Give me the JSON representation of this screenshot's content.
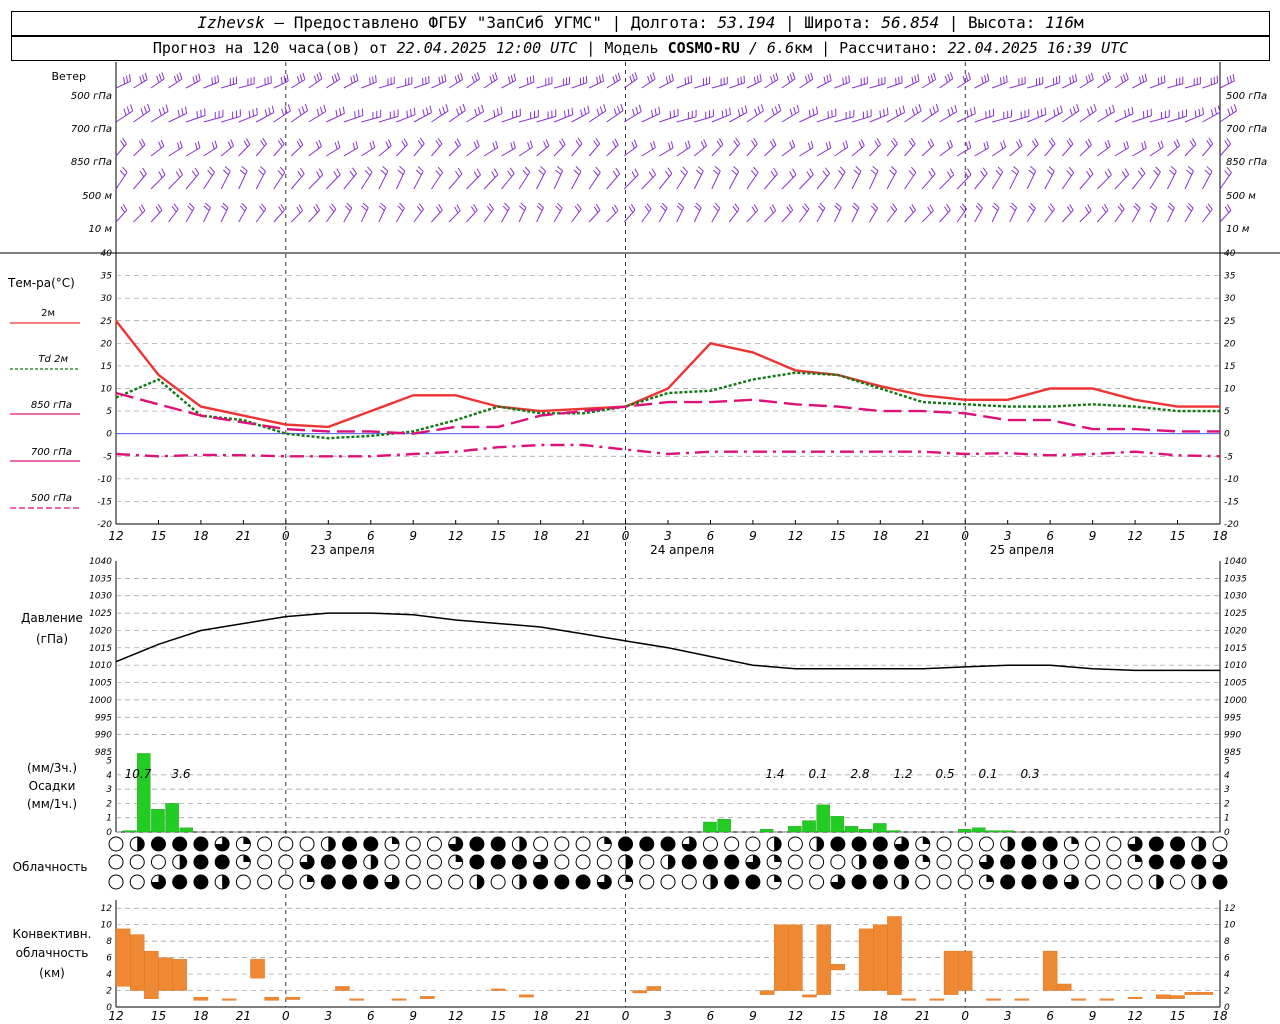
{
  "header": {
    "station": "Izhevsk",
    "provider": " – Предоставлено ФГБУ \"ЗапСиб УГМС\" | Долгота: ",
    "lon": "53.194",
    "lat_label": " | Широта: ",
    "lat": "56.854",
    "alt_label": " | Высота: ",
    "alt": "116",
    "alt_unit": "м",
    "forecast_label": "Прогноз на 120 часа(ов) от ",
    "forecast_start": "22.04.2025 12:00 UTC",
    "model_label": " | Модель ",
    "model": "COSMO-RU",
    "res": " / 6.6",
    "res_unit": "км",
    "calc_label": " | Рассчитано: ",
    "calc_time": "22.04.2025 16:39 UTC"
  },
  "colors": {
    "t2m": "#ee3333",
    "td2m": "#117711",
    "t850": "#dd1177",
    "t700": "#dd1177",
    "t500": "#dd1177",
    "wind": "#8833cc",
    "precip": "#22cc22",
    "convective": "#ee8833",
    "pressure": "#000000"
  },
  "x_ticks": [
    "12",
    "15",
    "18",
    "21",
    "0",
    "3",
    "6",
    "9",
    "12",
    "15",
    "18",
    "21",
    "0",
    "3",
    "6",
    "9",
    "12",
    "15",
    "18",
    "21",
    "0",
    "3",
    "6",
    "9",
    "12",
    "15",
    "18"
  ],
  "day_labels": [
    "23 апреля",
    "24 апреля",
    "25 апреля"
  ],
  "wind": {
    "title": "Ветер",
    "levels": [
      "500 гПа",
      "700 гПа",
      "850 гПа",
      "500 м",
      "10 м"
    ]
  },
  "temp_panel": {
    "title": "Тем-ра(°C)",
    "legend": [
      "2м",
      "Td 2м",
      "850 гПа",
      "700 гПа",
      "500 гПа"
    ],
    "y_ticks": [
      "40",
      "35",
      "30",
      "25",
      "20",
      "15",
      "10",
      "5",
      "0",
      "-5",
      "-10",
      "-15",
      "-20"
    ]
  },
  "pressure_panel": {
    "title": "Давление",
    "unit": "(гПа)",
    "y_ticks": [
      "1040",
      "1035",
      "1030",
      "1025",
      "1020",
      "1015",
      "1010",
      "1005",
      "1000",
      "995",
      "990",
      "985"
    ]
  },
  "precip_panel": {
    "unit_top": "(мм/3ч.)",
    "title": "Осадки",
    "unit_bottom": "(мм/1ч.)",
    "y_ticks": [
      "5",
      "4",
      "3",
      "2",
      "1",
      "0"
    ],
    "totals": [
      "10.7",
      "3.6",
      "1.4",
      "0.1",
      "2.8",
      "1.2",
      "0.5",
      "0.1",
      "0.3"
    ]
  },
  "cloud_panel": {
    "title": "Облачность"
  },
  "conv_panel": {
    "title1": "Конвективн.",
    "title2": "облачность",
    "unit": "(км)",
    "y_ticks": [
      "12",
      "10",
      "8",
      "6",
      "4",
      "2",
      "0"
    ]
  },
  "chart_data": [
    {
      "type": "line",
      "title": "",
      "ylabel": "Тем-ра(°C)",
      "ylim": [
        -20,
        40
      ],
      "x_hours": [
        0,
        3,
        6,
        9,
        12,
        15,
        18,
        21,
        24,
        27,
        30,
        33,
        36,
        39,
        42,
        45,
        48,
        51,
        54,
        57,
        60,
        63,
        66,
        69,
        72,
        75,
        78
      ],
      "series": [
        {
          "name": "2м",
          "values": [
            25,
            13,
            6,
            4,
            2,
            1.5,
            5,
            8.5,
            8.5,
            6,
            5,
            5.5,
            6,
            10,
            20,
            18,
            14,
            13,
            10.5,
            8.5,
            7.5,
            7.5,
            10,
            10,
            7.5,
            6,
            6
          ]
        },
        {
          "name": "Td 2м",
          "values": [
            8,
            12,
            4,
            3,
            0,
            -1,
            -0.5,
            0.5,
            3,
            6,
            4.5,
            4.5,
            6,
            9,
            9.5,
            12,
            13.5,
            13,
            10,
            7,
            6.5,
            6,
            6,
            6.5,
            6,
            5,
            5
          ]
        },
        {
          "name": "850 гПа",
          "values": [
            9,
            6.5,
            4,
            2.5,
            1,
            0.5,
            0.5,
            0,
            1.5,
            1.5,
            4,
            5,
            6,
            7,
            7,
            7.5,
            6.5,
            6,
            5,
            5,
            4.5,
            3,
            3,
            1,
            1,
            0.5,
            0.5
          ]
        },
        {
          "name": "700 гПа",
          "values": [
            -4.5,
            -5,
            -4.7,
            -4.8,
            -5,
            -5,
            -5,
            -4.5,
            -4,
            -3,
            -2.5,
            -2.5,
            -3.5,
            -4.5,
            -4,
            -4,
            -4,
            -4,
            -4,
            -4,
            -4.5,
            -4.3,
            -4.8,
            -4.5,
            -4,
            -4.8,
            -5
          ]
        }
      ]
    },
    {
      "type": "line",
      "ylabel": "Давление",
      "ylim": [
        985,
        1040
      ],
      "x_hours": [
        0,
        3,
        6,
        9,
        12,
        15,
        18,
        21,
        24,
        27,
        30,
        33,
        36,
        39,
        42,
        45,
        48,
        51,
        54,
        57,
        60,
        63,
        66,
        69,
        72,
        75,
        78
      ],
      "series": [
        {
          "name": "Давление",
          "values": [
            1011,
            1016,
            1020,
            1022,
            1024,
            1025,
            1025,
            1024.5,
            1023,
            1022,
            1021,
            1019,
            1017,
            1015,
            1012.5,
            1010,
            1009,
            1009,
            1009,
            1009,
            1009.5,
            1010,
            1010,
            1009,
            1008.5,
            1008.5,
            1008.5
          ]
        }
      ]
    },
    {
      "type": "bar",
      "ylabel": "Осадки",
      "ylim": [
        0,
        5
      ],
      "x_hours": [
        1,
        2,
        3,
        4,
        5,
        42,
        43,
        46,
        48,
        49,
        50,
        51,
        52,
        53,
        54,
        55,
        60,
        61,
        62,
        63
      ],
      "values": [
        0.1,
        5.5,
        1.6,
        2.0,
        0.3,
        0.7,
        0.9,
        0.2,
        0.4,
        0.8,
        1.9,
        1.1,
        0.4,
        0.2,
        0.6,
        0.1,
        0.2,
        0.3,
        0.1,
        0.1
      ]
    },
    {
      "type": "bar",
      "ylabel": "Конвективн. облачность (км)",
      "ylim": [
        0,
        12
      ],
      "segments": [
        {
          "h": 0.5,
          "lo": 2.5,
          "hi": 9.5
        },
        {
          "h": 1.5,
          "lo": 2.0,
          "hi": 8.8
        },
        {
          "h": 2.5,
          "lo": 1.0,
          "hi": 6.8
        },
        {
          "h": 3.5,
          "lo": 2.0,
          "hi": 6.0
        },
        {
          "h": 4.5,
          "lo": 2.0,
          "hi": 5.8
        },
        {
          "h": 6,
          "lo": 0.8,
          "hi": 1.2
        },
        {
          "h": 8,
          "lo": 0.8,
          "hi": 1.0
        },
        {
          "h": 10,
          "lo": 3.5,
          "hi": 5.8
        },
        {
          "h": 11,
          "lo": 0.8,
          "hi": 1.2
        },
        {
          "h": 12.5,
          "lo": 0.9,
          "hi": 1.2
        },
        {
          "h": 16,
          "lo": 2.0,
          "hi": 2.5
        },
        {
          "h": 17,
          "lo": 0.8,
          "hi": 1.0
        },
        {
          "h": 20,
          "lo": 0.8,
          "hi": 1.0
        },
        {
          "h": 22,
          "lo": 1.0,
          "hi": 1.3
        },
        {
          "h": 27,
          "lo": 2.0,
          "hi": 2.2
        },
        {
          "h": 29,
          "lo": 1.2,
          "hi": 1.5
        },
        {
          "h": 37,
          "lo": 1.7,
          "hi": 2.0
        },
        {
          "h": 38,
          "lo": 2.0,
          "hi": 2.5
        },
        {
          "h": 46,
          "lo": 1.5,
          "hi": 2.0
        },
        {
          "h": 47,
          "lo": 2.0,
          "hi": 10.0
        },
        {
          "h": 48,
          "lo": 2.0,
          "hi": 10.0
        },
        {
          "h": 49,
          "lo": 1.2,
          "hi": 1.5
        },
        {
          "h": 50,
          "lo": 1.5,
          "hi": 10.0
        },
        {
          "h": 51,
          "lo": 4.5,
          "hi": 5.2
        },
        {
          "h": 53,
          "lo": 2.0,
          "hi": 9.5
        },
        {
          "h": 54,
          "lo": 2.0,
          "hi": 10.0
        },
        {
          "h": 55,
          "lo": 1.5,
          "hi": 11.0
        },
        {
          "h": 56,
          "lo": 0.8,
          "hi": 1.0
        },
        {
          "h": 58,
          "lo": 0.8,
          "hi": 1.0
        },
        {
          "h": 59,
          "lo": 1.5,
          "hi": 6.8
        },
        {
          "h": 60,
          "lo": 2.0,
          "hi": 6.8
        },
        {
          "h": 62,
          "lo": 0.8,
          "hi": 1.0
        },
        {
          "h": 64,
          "lo": 0.8,
          "hi": 1.0
        },
        {
          "h": 66,
          "lo": 2.0,
          "hi": 6.8
        },
        {
          "h": 67,
          "lo": 2.0,
          "hi": 2.8
        },
        {
          "h": 68,
          "lo": 0.8,
          "hi": 1.0
        },
        {
          "h": 70,
          "lo": 0.8,
          "hi": 1.0
        },
        {
          "h": 72,
          "lo": 1.0,
          "hi": 1.2
        },
        {
          "h": 74,
          "lo": 1.0,
          "hi": 1.5
        },
        {
          "h": 75,
          "lo": 1.0,
          "hi": 1.4
        },
        {
          "h": 76,
          "lo": 1.5,
          "hi": 1.8
        },
        {
          "h": 77,
          "lo": 1.5,
          "hi": 1.8
        }
      ]
    }
  ]
}
